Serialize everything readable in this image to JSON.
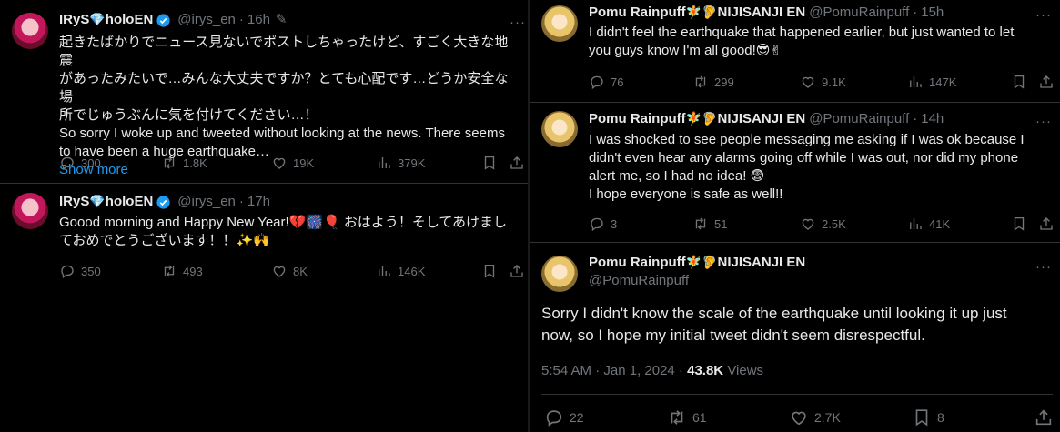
{
  "left": {
    "tweets": [
      {
        "name": "IRyS",
        "name_suffix": "holoEN",
        "handle": "@irys_en",
        "time": "16h",
        "body_lines": [
          "起きたばかりでニュース見ないでポストしちゃったけど、すごく大きな地震",
          "があったみたいで…みんな大丈夫ですか？とても心配です…どうか安全な場",
          "所でじゅうぶんに気を付けてください…！",
          "So sorry I woke up and tweeted without looking at the news. There seems",
          "to have been a huge earthquake…"
        ],
        "show_more": "Show more",
        "replies": "300",
        "reposts": "1.8K",
        "likes": "19K",
        "views": "379K"
      },
      {
        "name": "IRyS",
        "name_suffix": "holoEN",
        "handle": "@irys_en",
        "time": "17h",
        "body_lines": [
          "Goood morning and Happy New Year!💔🎆🎈 おはよう！そしてあけまし",
          "ておめでとうございます！！✨🙌"
        ],
        "replies": "350",
        "reposts": "493",
        "likes": "8K",
        "views": "146K"
      }
    ]
  },
  "right": {
    "tweets": [
      {
        "name": "Pomu Rainpuff",
        "name_suffix": "NIJISANJI EN",
        "handle": "@PomuRainpuff",
        "time": "15h",
        "body_lines": [
          "I didn't feel the earthquake that happened earlier, but just wanted to let",
          "you guys know I'm all good!😎✌"
        ],
        "replies": "76",
        "reposts": "299",
        "likes": "9.1K",
        "views": "147K"
      },
      {
        "name": "Pomu Rainpuff",
        "name_suffix": "NIJISANJI EN",
        "handle": "@PomuRainpuff",
        "time": "14h",
        "body_lines": [
          "I was shocked to see people messaging me asking if I was ok because I",
          "didn't even hear any alarms going off while I was out, nor did my phone",
          "alert me, so I had no idea! 😨",
          "I hope everyone is safe as well!!"
        ],
        "replies": "3",
        "reposts": "51",
        "likes": "2.5K",
        "views": "41K"
      }
    ],
    "main": {
      "name": "Pomu Rainpuff",
      "name_suffix": "NIJISANJI EN",
      "handle": "@PomuRainpuff",
      "body_lines": [
        "Sorry I didn't know the scale of the earthquake until looking it up just",
        "now, so I hope my initial tweet didn't seem disrespectful."
      ],
      "timestamp": "5:54 AM · Jan 1, 2024 ·",
      "views_count": "43.8K",
      "views_label": "Views",
      "replies": "22",
      "reposts": "61",
      "likes": "2.7K",
      "bookmarks": "8"
    }
  },
  "glyphs": {
    "verified_check": "✓",
    "edit": "✎",
    "more": "···",
    "gem": "💎",
    "pomu_emoji": "🧚🦻"
  }
}
